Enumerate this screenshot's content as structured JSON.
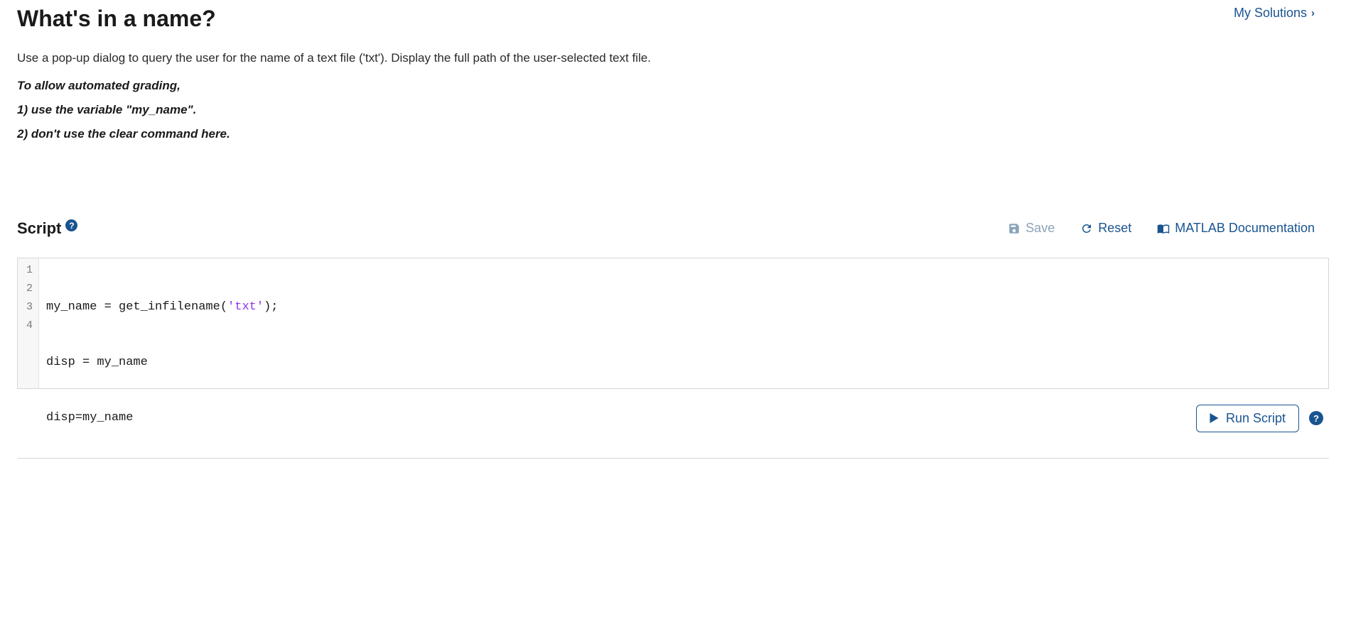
{
  "header": {
    "title": "What's in a name?",
    "my_solutions_label": "My Solutions"
  },
  "problem": {
    "description": "Use a pop-up dialog to query the user for the name of a text file ('txt'). Display the full path of the user-selected text file.",
    "grading_intro": "To allow automated grading,",
    "rule1": "1)  use the variable \"my_name\".",
    "rule2": "2) don't use the clear command here."
  },
  "script": {
    "title": "Script",
    "save_label": "Save",
    "reset_label": "Reset",
    "docs_label": "MATLAB Documentation",
    "run_label": "Run Script",
    "code_lines": [
      {
        "n": "1",
        "pre": "my_name = get_infilename(",
        "str": "'txt'",
        "post": ");"
      },
      {
        "n": "2",
        "pre": "disp = my_name",
        "str": "",
        "post": ""
      },
      {
        "n": "3",
        "pre": "disp=my_name",
        "str": "",
        "post": ""
      },
      {
        "n": "4",
        "pre": "",
        "str": "",
        "post": ""
      }
    ]
  }
}
